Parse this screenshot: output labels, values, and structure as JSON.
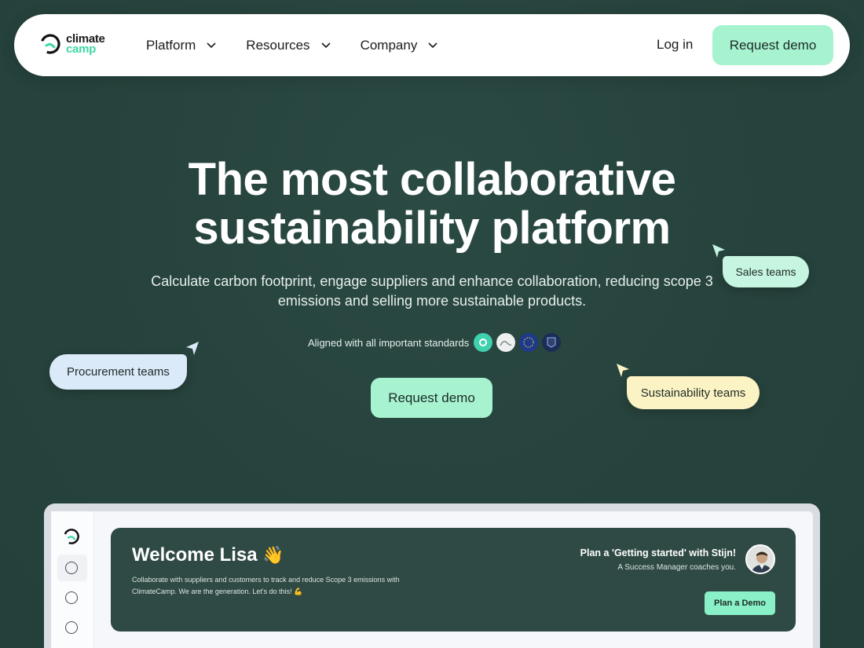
{
  "nav": {
    "logo_line1": "climate",
    "logo_line2": "camp",
    "menu": [
      {
        "label": "Platform"
      },
      {
        "label": "Resources"
      },
      {
        "label": "Company"
      }
    ],
    "login_label": "Log in",
    "demo_label": "Request demo"
  },
  "hero": {
    "title_line1": "The most collaborative",
    "title_line2": "sustainability platform",
    "subtitle": "Calculate carbon footprint, engage suppliers and enhance collaboration, reducing scope 3 emissions and selling more sustainable products.",
    "standards_label": "Aligned with all important standards",
    "standards_icons": [
      "ghg-protocol-icon",
      "sbti-icon",
      "csrd-icon",
      "pact-icon"
    ],
    "demo_label": "Request demo"
  },
  "tags": {
    "sales": "Sales teams",
    "procurement": "Procurement teams",
    "sustainability": "Sustainability teams"
  },
  "preview": {
    "welcome": "Welcome Lisa",
    "wave_emoji": "👋",
    "description": "Collaborate with suppliers and customers to track and reduce Scope 3 emissions with ClimateCamp. We are the generation. Let's do this! 💪",
    "plan_title": "Plan a 'Getting started' with Stijn!",
    "plan_sub": "A Success Manager coaches you.",
    "plan_button": "Plan a Demo"
  },
  "colors": {
    "background": "#27433d",
    "accent_mint": "#a7f3cf",
    "logo_green": "#3ed8a4",
    "banner": "#2f4a44"
  }
}
